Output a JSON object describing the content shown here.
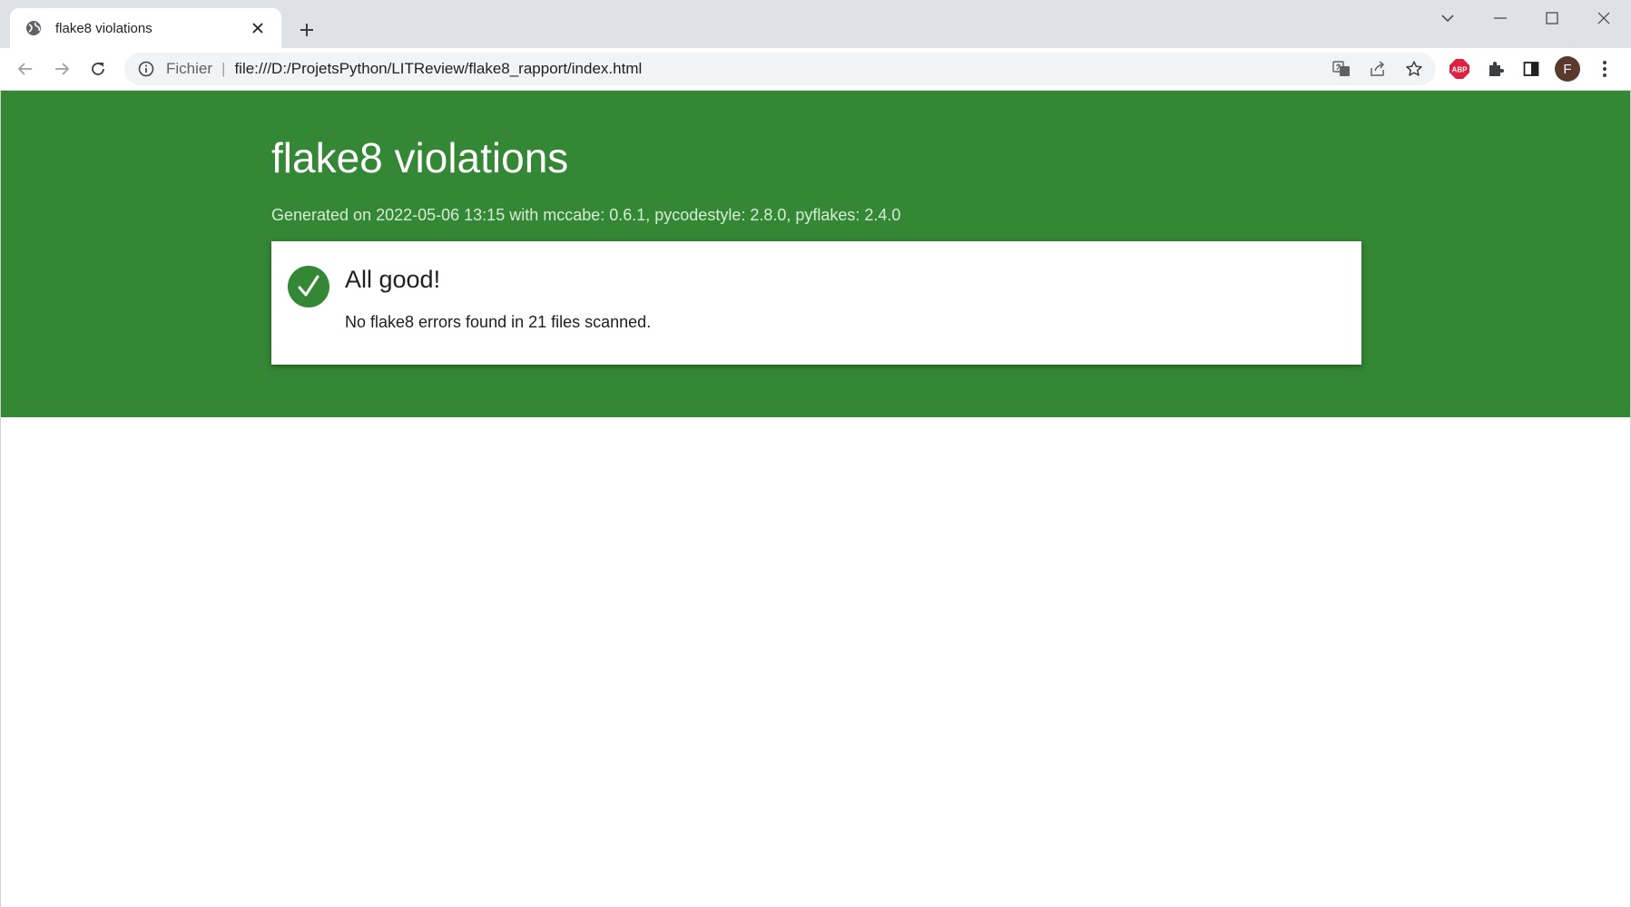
{
  "browser": {
    "tab": {
      "title": "flake8 violations"
    },
    "address": {
      "scheme_label": "Fichier",
      "url": "file:///D:/ProjetsPython/LITReview/flake8_rapport/index.html"
    },
    "profile_initial": "F",
    "extension_badge": "ABP",
    "colors": {
      "tabstrip": "#dee1e6",
      "omnibox": "#f1f3f4",
      "abp_red": "#e0203f",
      "avatar": "#5b3a2e"
    }
  },
  "page": {
    "title": "flake8 violations",
    "generated": "Generated on 2022-05-06 13:15 with mccabe: 0.6.1, pycodestyle: 2.8.0, pyflakes: 2.4.0",
    "result": {
      "heading": "All good!",
      "message": "No flake8 errors found in 21 files scanned."
    },
    "colors": {
      "accent": "#348734"
    },
    "icons": {
      "status": "checkmark-icon"
    }
  }
}
